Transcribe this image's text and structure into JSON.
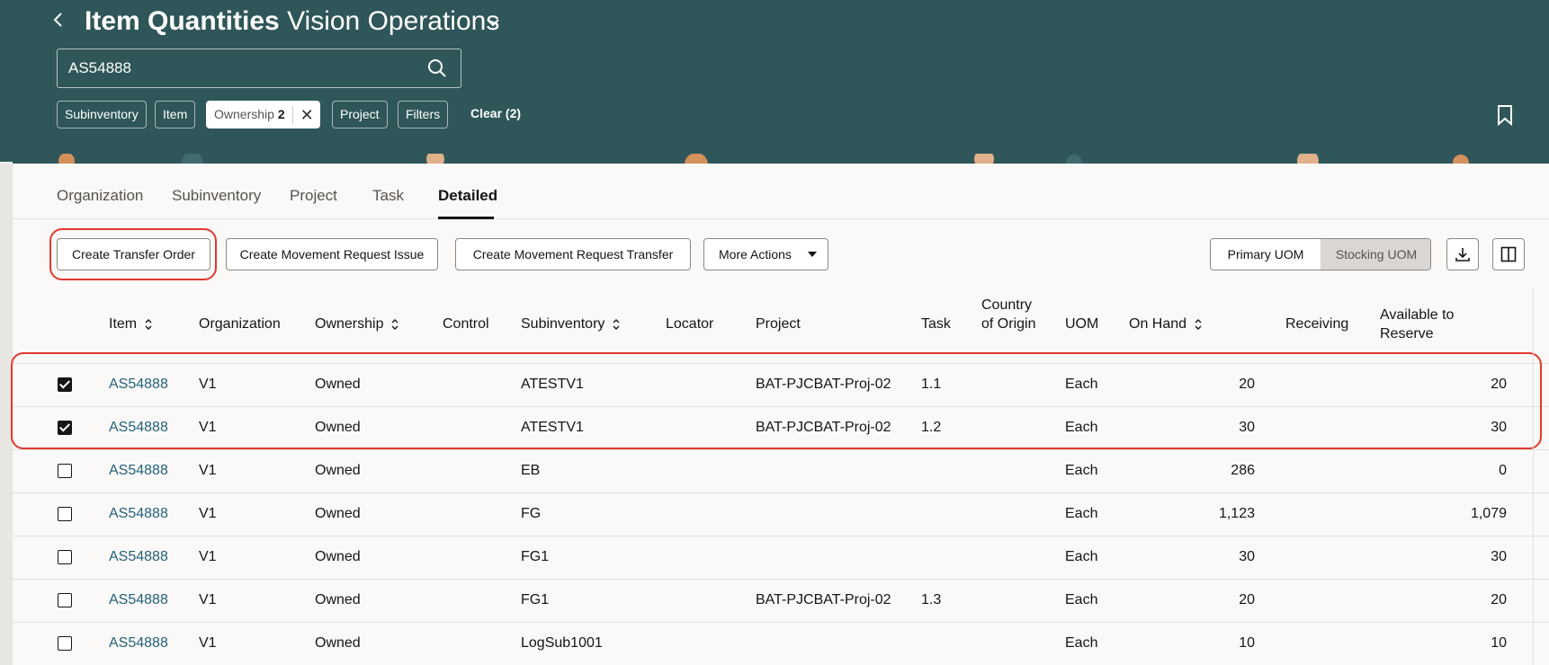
{
  "header": {
    "title_bold": "Item Quantities",
    "title_rest": "Vision Operations",
    "search_value": "AS54888",
    "filters": [
      {
        "label": "Subinventory"
      },
      {
        "label": "Item"
      },
      {
        "label": "Ownership",
        "count": "2"
      },
      {
        "label": "Project"
      },
      {
        "label": "Filters"
      }
    ],
    "clear_label": "Clear (2)"
  },
  "tabs": [
    "Organization",
    "Subinventory",
    "Project",
    "Task",
    "Detailed"
  ],
  "selected_tab": "Detailed",
  "toolbar": {
    "create_transfer_order": "Create Transfer Order",
    "create_movement_request_issue": "Create Movement Request Issue",
    "create_movement_request_transfer": "Create Movement Request Transfer",
    "more_actions": "More Actions",
    "primary_uom": "Primary UOM",
    "stocking_uom": "Stocking UOM"
  },
  "table": {
    "columns": {
      "item": "Item",
      "organization": "Organization",
      "ownership": "Ownership",
      "control": "Control",
      "subinventory": "Subinventory",
      "locator": "Locator",
      "project": "Project",
      "task": "Task",
      "country": "Country of Origin",
      "uom": "UOM",
      "on_hand": "On Hand",
      "receiving": "Receiving",
      "available": "Available to Reserve"
    },
    "rows": [
      {
        "checked": true,
        "item": "AS54888",
        "org": "V1",
        "ownership": "Owned",
        "subinventory": "ATESTV1",
        "project": "BAT-PJCBAT-Proj-02",
        "task": "1.1",
        "uom": "Each",
        "on_hand": "20",
        "available": "20"
      },
      {
        "checked": true,
        "item": "AS54888",
        "org": "V1",
        "ownership": "Owned",
        "subinventory": "ATESTV1",
        "project": "BAT-PJCBAT-Proj-02",
        "task": "1.2",
        "uom": "Each",
        "on_hand": "30",
        "available": "30"
      },
      {
        "checked": false,
        "item": "AS54888",
        "org": "V1",
        "ownership": "Owned",
        "subinventory": "EB",
        "project": "",
        "task": "",
        "uom": "Each",
        "on_hand": "286",
        "available": "0"
      },
      {
        "checked": false,
        "item": "AS54888",
        "org": "V1",
        "ownership": "Owned",
        "subinventory": "FG",
        "project": "",
        "task": "",
        "uom": "Each",
        "on_hand": "1,123",
        "available": "1,079"
      },
      {
        "checked": false,
        "item": "AS54888",
        "org": "V1",
        "ownership": "Owned",
        "subinventory": "FG1",
        "project": "",
        "task": "",
        "uom": "Each",
        "on_hand": "30",
        "available": "30"
      },
      {
        "checked": false,
        "item": "AS54888",
        "org": "V1",
        "ownership": "Owned",
        "subinventory": "FG1",
        "project": "BAT-PJCBAT-Proj-02",
        "task": "1.3",
        "uom": "Each",
        "on_hand": "20",
        "available": "20"
      },
      {
        "checked": false,
        "item": "AS54888",
        "org": "V1",
        "ownership": "Owned",
        "subinventory": "LogSub1001",
        "project": "",
        "task": "",
        "uom": "Each",
        "on_hand": "10",
        "available": "10"
      }
    ]
  },
  "colors": {
    "header_bg": "#2f5659",
    "link": "#22617a",
    "highlight": "#e0392f"
  }
}
